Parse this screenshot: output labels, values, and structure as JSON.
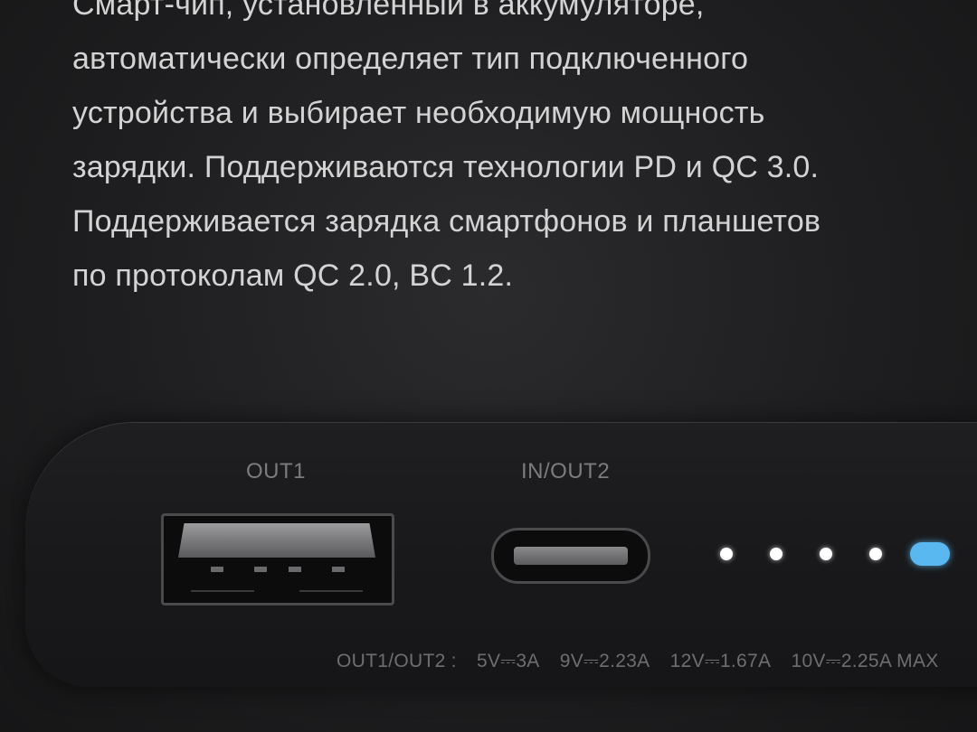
{
  "description": {
    "lines": [
      "Смарт-чип, установленный в аккумуляторе,",
      "автоматически определяет тип подключенного",
      "устройства и выбирает необходимую мощность",
      "зарядки. Поддерживаются технологии PD и QC 3.0.",
      "Поддерживается зарядка смартфонов и планшетов",
      "по протоколам QC 2.0, BC 1.2."
    ]
  },
  "device": {
    "port1_label": "OUT1",
    "port2_label": "IN/OUT2",
    "spec": {
      "prefix": "OUT1/OUT2 :",
      "items": [
        "5V⎓3A",
        "9V⎓2.23A",
        "12V⎓1.67A",
        "10V⎓2.25A MAX"
      ]
    },
    "led_count": 5,
    "led_colors": {
      "white": "#ffffff",
      "blue": "#5ab8f0"
    }
  }
}
